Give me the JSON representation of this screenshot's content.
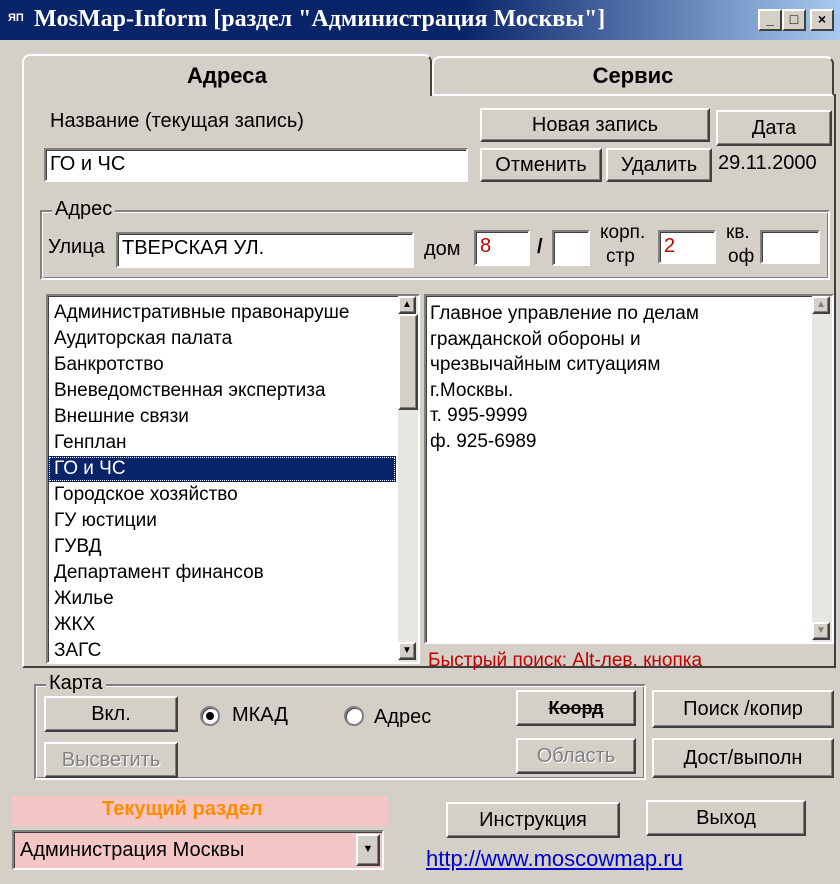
{
  "window": {
    "title": "MosMap-Inform  [раздел \"Администрация Москвы\"]",
    "app_icon": "ЯП",
    "minimize": "_",
    "maximize": "□",
    "close": "×"
  },
  "tabs": [
    {
      "label": "Адреса",
      "active": true
    },
    {
      "label": "Сервис",
      "active": false
    }
  ],
  "record": {
    "name_label": "Название (текущая запись)",
    "name_value": "ГО и ЧС",
    "new_record_button": "Новая запись",
    "date_button": "Дата",
    "cancel_button": "Отменить",
    "delete_button": "Удалить",
    "date_value": "29.11.2000"
  },
  "address": {
    "group_label": "Адрес",
    "street_label": "Улица",
    "street_value": "ТВЕРСКАЯ УЛ.",
    "house_label": "дом",
    "house_value": "8",
    "slash": "/",
    "fraction_value": "",
    "korp_label": "корп.",
    "str_label": "стр",
    "korp_value": "2",
    "kv_label": "кв.",
    "of_label": "оф",
    "kv_value": ""
  },
  "sections_list": {
    "items": [
      "Административные правонаруше",
      "Аудиторская палата",
      "Банкротство",
      "Вневедомственная экспертиза",
      "Внешние связи",
      "Генплан",
      "ГО и ЧС",
      "Городское хозяйство",
      "ГУ юстиции",
      "ГУВД",
      "Департамент финансов",
      "Жилье",
      "ЖКХ",
      "ЗАГС"
    ],
    "selected_index": 6
  },
  "details": {
    "lines": [
      "Главное управление по делам",
      "гражданской обороны и",
      "чрезвычайным ситуациям",
      "г.Москвы.",
      "т. 995-9999",
      "ф. 925-6989"
    ],
    "quick_search_hint": "Быстрый поиск: Alt-лев. кнопка"
  },
  "map": {
    "group_label": "Карта",
    "on_button": "Вкл.",
    "highlight_button": "Высветить",
    "radio_mkad": "МКАД",
    "radio_address": "Адрес",
    "radio_selected": "МКАД",
    "coord_button": "Коорд",
    "area_button": "Область",
    "search_copy_button": "Поиск /копир",
    "dost_button": "Дост/выполн"
  },
  "footer": {
    "current_section_label": "Текущий раздел",
    "current_section_value": "Администрация Москвы",
    "instruction_button": "Инструкция",
    "exit_button": "Выход",
    "website_link": "http://www.moscowmap.ru"
  },
  "colors": {
    "window_bg": "#d4d0c8",
    "titlebar": "#0a246a",
    "selection": "#0a246a",
    "accent_red": "#c00000",
    "current_section_bg": "#f4c6c6",
    "current_section_text": "#ff8c00",
    "link": "#0000cc"
  }
}
